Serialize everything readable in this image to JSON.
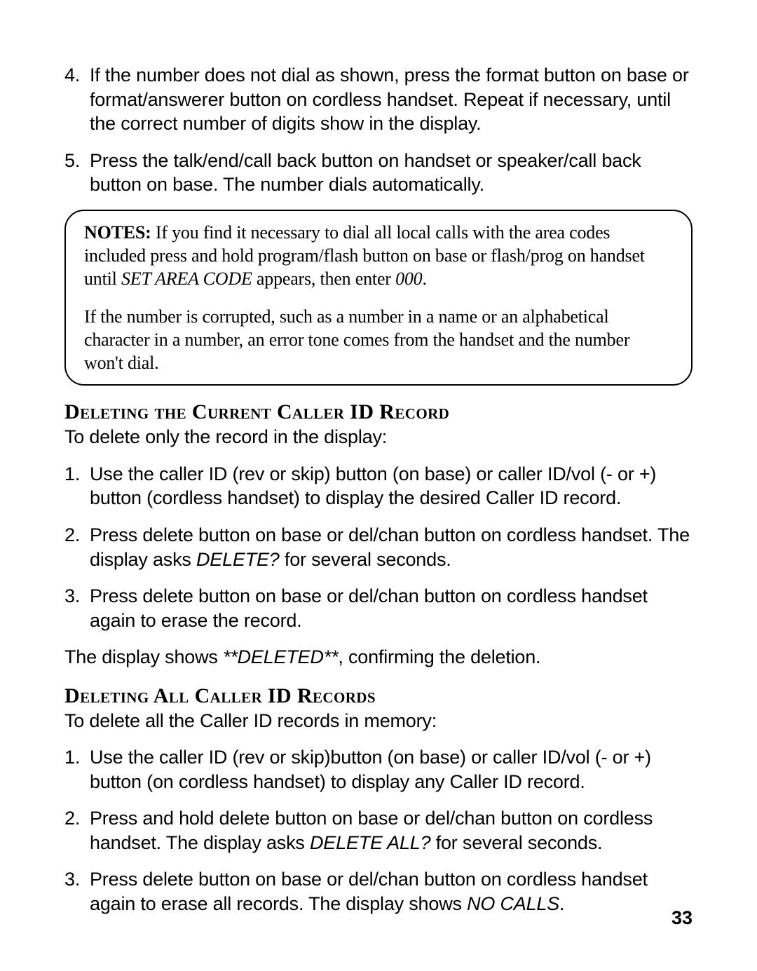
{
  "list1": {
    "item4": {
      "num": "4.",
      "text": "If the number does not dial as shown, press the format button on base or format/answerer button on cordless handset. Repeat if necessary, until the correct number of digits show in the display."
    },
    "item5": {
      "num": "5.",
      "text": "Press the talk/end/call back button on handset or speaker/call back button on base. The number dials automatically."
    }
  },
  "notes": {
    "label": "NOTES:",
    "p1_a": " If you find it necessary to dial all local calls with the area codes included press and hold program/flash button on base or flash/prog on handset until ",
    "p1_set": "SET AREA CODE",
    "p1_b": " appears, then enter ",
    "p1_zero": "000",
    "p1_c": ".",
    "p2": "If the number is corrupted, such as a number in a name or an alphabetical character in a number, an error tone comes from the handset and the number won't dial."
  },
  "section1": {
    "heading": "Deleting the Current Caller ID Record",
    "intro": "To delete only the record in the display:",
    "items": {
      "i1": {
        "num": "1.",
        "text": "Use the caller ID (rev or skip) button (on base) or caller ID/vol (- or +) button (cordless handset) to display the desired Caller ID record."
      },
      "i2": {
        "num": "2.",
        "text_a": "Press delete button on base or del/chan button on cordless handset. The display asks ",
        "italic": "DELETE?",
        "text_b": " for several seconds."
      },
      "i3": {
        "num": "3.",
        "text": "Press delete button on base or del/chan button on cordless handset again to erase the record."
      }
    },
    "outro_a": "The display shows ",
    "outro_italic": "**DELETED**",
    "outro_b": ", confirming the deletion."
  },
  "section2": {
    "heading": "Deleting All Caller ID Records",
    "intro": "To delete all the Caller ID records in memory:",
    "items": {
      "i1": {
        "num": "1.",
        "text": "Use the caller ID (rev or skip)button (on base) or caller ID/vol (- or +) button (on cordless handset) to display any Caller ID record."
      },
      "i2": {
        "num": "2.",
        "text_a": "Press and hold delete button on base or del/chan button on cordless handset. The display asks ",
        "italic": "DELETE ALL?",
        "text_b": " for several seconds."
      },
      "i3": {
        "num": "3.",
        "text_a": "Press delete button on base or del/chan button on cordless handset again to erase all records. The display shows ",
        "italic": "NO CALLS",
        "text_b": "."
      }
    }
  },
  "page_number": "33"
}
